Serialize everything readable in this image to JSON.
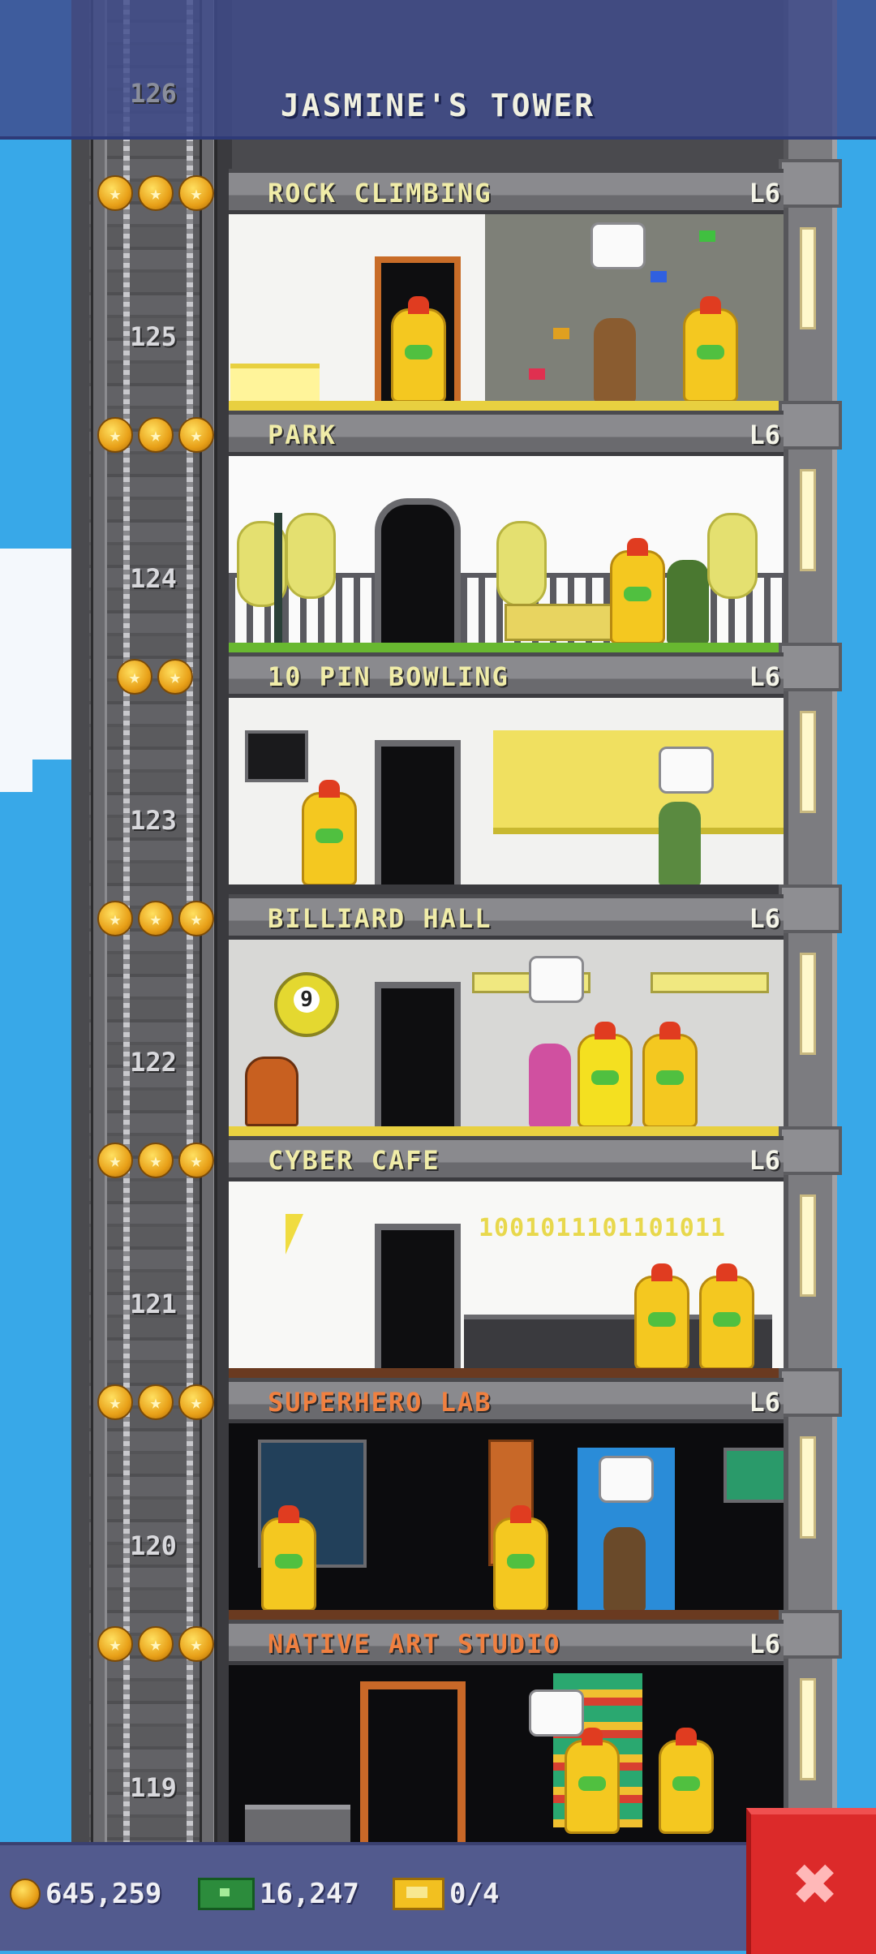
{
  "header": {
    "title": "JASMINE'S TOWER",
    "top_floor_number": "126"
  },
  "floors": [
    {
      "number": "125",
      "name": "ROCK CLIMBING",
      "level": "L6",
      "stars": 3,
      "name_color": "#f0eca8"
    },
    {
      "number": "124",
      "name": "PARK",
      "level": "L6",
      "stars": 3,
      "name_color": "#f0eca8"
    },
    {
      "number": "123",
      "name": "10 PIN BOWLING",
      "level": "L6",
      "stars": 2,
      "name_color": "#f0eca8"
    },
    {
      "number": "122",
      "name": "BILLIARD HALL",
      "level": "L6",
      "stars": 3,
      "name_color": "#f0eca8"
    },
    {
      "number": "121",
      "name": "CYBER CAFE",
      "level": "L6",
      "stars": 3,
      "name_color": "#f0eca8",
      "display_text": "1001011101101011"
    },
    {
      "number": "120",
      "name": "SUPERHERO LAB",
      "level": "L6",
      "stars": 3,
      "name_color": "#f08040"
    },
    {
      "number": "119",
      "name": "NATIVE ART STUDIO",
      "level": "L6",
      "stars": 3,
      "name_color": "#f08040"
    }
  ],
  "billiard_ball_label": "9",
  "bottom_bar": {
    "coins": "645,259",
    "bux": "16,247",
    "vip_tickets": "0/4",
    "close_label": "✖"
  },
  "colors": {
    "sky": "#38a8e8",
    "header": "#404c8c",
    "close_button": "#dc2a2a",
    "bottom_bar": "#525a8e"
  },
  "icons": [
    "coin-icon",
    "bux-icon",
    "ticket-icon",
    "close-icon",
    "star-icon"
  ]
}
